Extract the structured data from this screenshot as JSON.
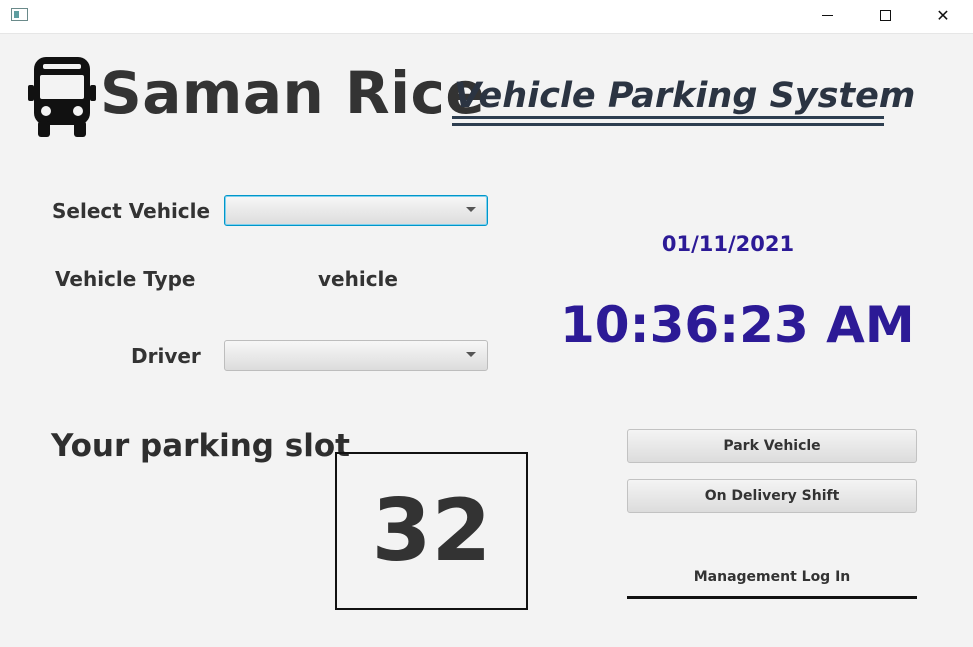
{
  "window": {
    "icons": {
      "app": "app-window-icon",
      "minimize": "minimize-icon",
      "maximize": "maximize-icon",
      "close": "close-icon"
    },
    "close_glyph": "✕"
  },
  "header": {
    "logo_icon": "bus-icon",
    "brand": "Saman Rice",
    "subtitle": "Vehicle Parking System "
  },
  "form": {
    "select_vehicle_label": "Select Vehicle",
    "select_vehicle_value": "",
    "vehicle_type_label": "Vehicle Type",
    "vehicle_type_value": "vehicle",
    "driver_label": "Driver",
    "driver_value": ""
  },
  "datetime": {
    "date": "01/11/2021",
    "time": "10:36:23 AM"
  },
  "parking": {
    "title": "Your parking slot",
    "slot_number": "32"
  },
  "actions": {
    "park_vehicle": "Park Vehicle",
    "on_delivery_shift": "On Delivery Shift",
    "management_login": "Management Log In"
  },
  "colors": {
    "accent_clock": "#2c1a96",
    "subtitle": "#2b3442",
    "focus_border": "#0096c9"
  }
}
